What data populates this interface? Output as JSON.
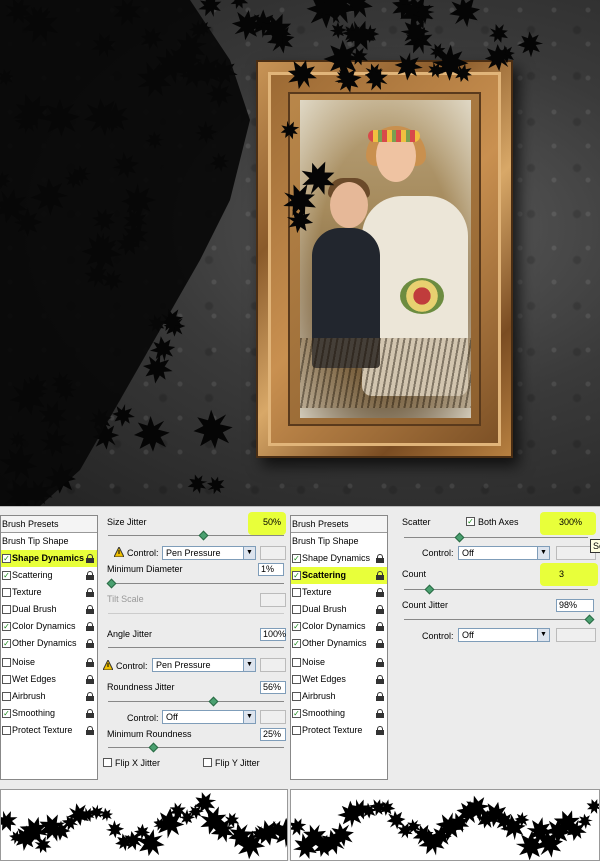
{
  "colors": {
    "highlight": "#e8ff3a",
    "check": "#1a8a1a",
    "slider_thumb": "#4aa070"
  },
  "left_panel": {
    "presets_label": "Brush Presets",
    "tip_shape_label": "Brush Tip Shape",
    "items": [
      {
        "label": "Shape Dynamics",
        "checked": true,
        "selected": true,
        "highlighted": true
      },
      {
        "label": "Scattering",
        "checked": true
      },
      {
        "label": "Texture",
        "checked": false
      },
      {
        "label": "Dual Brush",
        "checked": false
      },
      {
        "label": "Color Dynamics",
        "checked": true
      },
      {
        "label": "Other Dynamics",
        "checked": true
      },
      {
        "label": "Noise",
        "checked": false
      },
      {
        "label": "Wet Edges",
        "checked": false
      },
      {
        "label": "Airbrush",
        "checked": false
      },
      {
        "label": "Smoothing",
        "checked": true
      },
      {
        "label": "Protect Texture",
        "checked": false
      }
    ],
    "options": {
      "size_jitter_label": "Size Jitter",
      "size_jitter_value": "50%",
      "control_label": "Control:",
      "control_1": "Pen Pressure",
      "min_diameter_label": "Minimum Diameter",
      "min_diameter_value": "1%",
      "tilt_scale_label": "Tilt Scale",
      "angle_jitter_label": "Angle Jitter",
      "angle_jitter_value": "100%",
      "control_2": "Pen Pressure",
      "roundness_jitter_label": "Roundness Jitter",
      "roundness_jitter_value": "56%",
      "control_3": "Off",
      "min_roundness_label": "Minimum Roundness",
      "min_roundness_value": "25%",
      "flip_x_label": "Flip X Jitter",
      "flip_y_label": "Flip Y Jitter"
    }
  },
  "right_panel": {
    "presets_label": "Brush Presets",
    "tip_shape_label": "Brush Tip Shape",
    "items": [
      {
        "label": "Shape Dynamics",
        "checked": true
      },
      {
        "label": "Scattering",
        "checked": true,
        "selected": true,
        "highlighted": true
      },
      {
        "label": "Texture",
        "checked": false
      },
      {
        "label": "Dual Brush",
        "checked": false
      },
      {
        "label": "Color Dynamics",
        "checked": true
      },
      {
        "label": "Other Dynamics",
        "checked": true
      },
      {
        "label": "Noise",
        "checked": false
      },
      {
        "label": "Wet Edges",
        "checked": false
      },
      {
        "label": "Airbrush",
        "checked": false
      },
      {
        "label": "Smoothing",
        "checked": true
      },
      {
        "label": "Protect Texture",
        "checked": false
      }
    ],
    "options": {
      "scatter_label": "Scatter",
      "both_axes_label": "Both Axes",
      "scatter_value": "300%",
      "control_label": "Control:",
      "control_1": "Off",
      "count_label": "Count",
      "count_value": "3",
      "count_jitter_label": "Count Jitter",
      "count_jitter_value": "98%",
      "control_2": "Off",
      "tooltip_text": "Se"
    }
  }
}
